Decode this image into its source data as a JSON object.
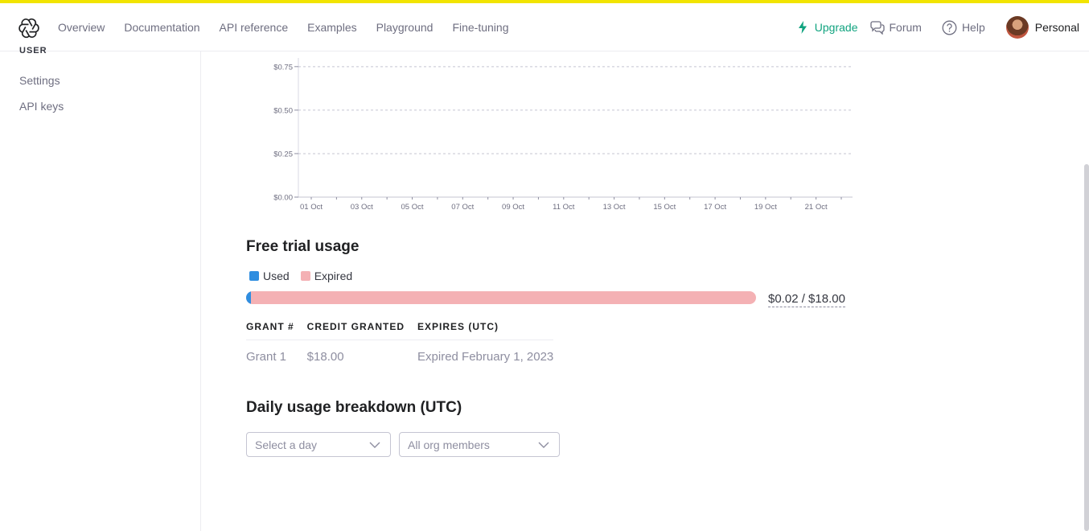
{
  "nav": {
    "links": [
      "Overview",
      "Documentation",
      "API reference",
      "Examples",
      "Playground",
      "Fine-tuning"
    ],
    "upgrade": "Upgrade",
    "forum": "Forum",
    "help": "Help",
    "account": "Personal"
  },
  "sidebar": {
    "heading": "USER",
    "items": [
      "Settings",
      "API keys"
    ]
  },
  "chart_data": {
    "type": "bar",
    "categories": [
      "01 Oct",
      "03 Oct",
      "05 Oct",
      "07 Oct",
      "09 Oct",
      "11 Oct",
      "13 Oct",
      "15 Oct",
      "17 Oct",
      "19 Oct",
      "21 Oct"
    ],
    "values": [
      0,
      0,
      0,
      0,
      0,
      0,
      0,
      0,
      0,
      0,
      0
    ],
    "y_ticks": [
      "$0.00",
      "$0.25",
      "$0.50",
      "$0.75"
    ],
    "ylim": [
      0,
      0.8
    ],
    "grid": true
  },
  "free_trial": {
    "title": "Free trial usage",
    "legend": {
      "used": "Used",
      "expired": "Expired"
    },
    "used_fraction": 0.0011,
    "total_label": "$0.02 / $18.00",
    "colors": {
      "used": "#2f8ee0",
      "expired": "#f4b1b4"
    },
    "table": {
      "headers": [
        "GRANT #",
        "CREDIT GRANTED",
        "EXPIRES (UTC)"
      ],
      "rows": [
        [
          "Grant 1",
          "$18.00",
          "Expired February 1, 2023"
        ]
      ]
    }
  },
  "daily": {
    "title": "Daily usage breakdown (UTC)",
    "day_select": "Select a day",
    "members_select": "All org members"
  }
}
